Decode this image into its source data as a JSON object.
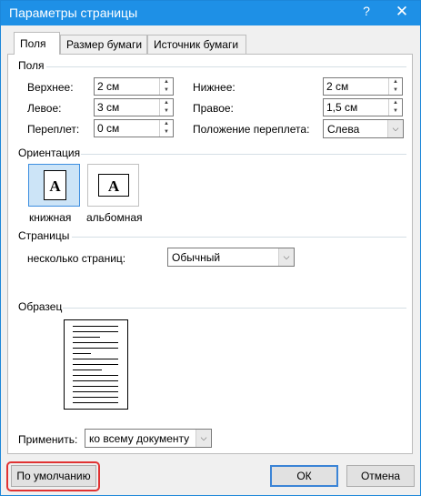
{
  "window": {
    "title": "Параметры страницы",
    "help_glyph": "?",
    "close_glyph": "✕"
  },
  "tabs": [
    {
      "label": "Поля",
      "active": true
    },
    {
      "label": "Размер бумаги",
      "active": false
    },
    {
      "label": "Источник бумаги",
      "active": false
    }
  ],
  "margins": {
    "group_label": "Поля",
    "top": {
      "label": "Верхнее:",
      "value": "2 см"
    },
    "bottom": {
      "label": "Нижнее:",
      "value": "2 см"
    },
    "left": {
      "label": "Левое:",
      "value": "3 см"
    },
    "right": {
      "label": "Правое:",
      "value": "1,5 см"
    },
    "gutter": {
      "label": "Переплет:",
      "value": "0 см"
    },
    "gutter_pos": {
      "label": "Положение переплета:",
      "value": "Слева"
    }
  },
  "orientation": {
    "group_label": "Ориентация",
    "portrait": {
      "label": "книжная",
      "glyph": "A"
    },
    "landscape": {
      "label": "альбомная",
      "glyph": "A"
    }
  },
  "pages": {
    "group_label": "Страницы",
    "multiple_label": "несколько страниц:",
    "multiple_value": "Обычный"
  },
  "preview": {
    "group_label": "Образец"
  },
  "apply": {
    "label": "Применить:",
    "value": "ко всему документу"
  },
  "buttons": {
    "default": "По умолчанию",
    "ok": "ОК",
    "cancel": "Отмена"
  },
  "icons": {
    "spin_up": "▲",
    "spin_down": "▼",
    "dropdown": "⌵"
  },
  "colors": {
    "titlebar": "#1e90e6",
    "highlight": "#e03232",
    "default_button_border": "#3b84d6"
  }
}
